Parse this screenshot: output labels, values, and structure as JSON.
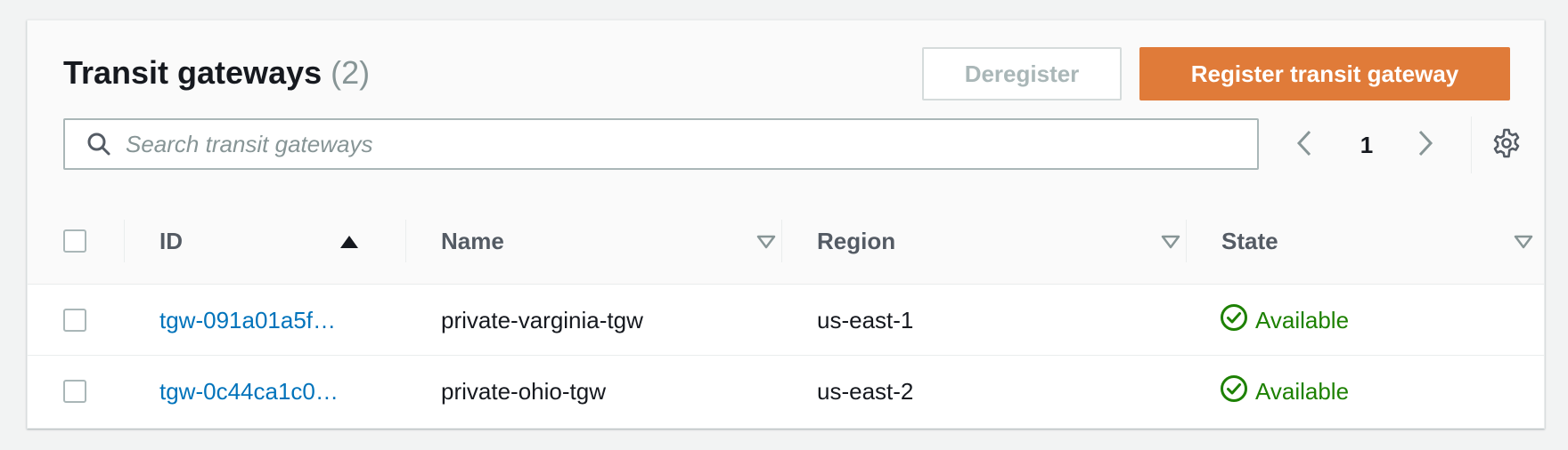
{
  "header": {
    "title": "Transit gateways",
    "count": "(2)",
    "deregister_label": "Deregister",
    "register_label": "Register transit gateway"
  },
  "search": {
    "placeholder": "Search transit gateways",
    "value": ""
  },
  "pagination": {
    "current_page": "1"
  },
  "table": {
    "columns": [
      {
        "label": "ID",
        "sort": "ascending"
      },
      {
        "label": "Name",
        "sort": "none"
      },
      {
        "label": "Region",
        "sort": "none"
      },
      {
        "label": "State",
        "sort": "none"
      }
    ],
    "rows": [
      {
        "id": "tgw-091a01a5f…",
        "name": "private-varginia-tgw",
        "region": "us-east-1",
        "state": "Available"
      },
      {
        "id": "tgw-0c44ca1c0…",
        "name": "private-ohio-tgw",
        "region": "us-east-2",
        "state": "Available"
      }
    ]
  },
  "colors": {
    "primary_button": "#e07b39",
    "link": "#0073bb",
    "status_success": "#1d8102"
  },
  "icons": {
    "search": "search-icon",
    "prev": "chevron-left-icon",
    "next": "chevron-right-icon",
    "settings": "gear-icon",
    "sort_asc": "caret-up-icon",
    "sort_none": "caret-down-outline-icon",
    "status": "check-circle-icon"
  }
}
